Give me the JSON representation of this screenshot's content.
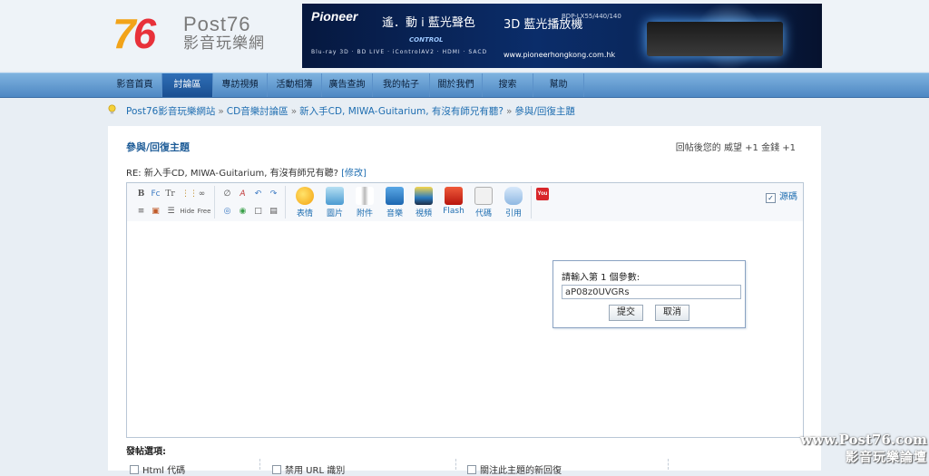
{
  "logo": {
    "num_seven": "7",
    "num_six": "6",
    "post": "Post76",
    "subtitle": "影音玩樂網"
  },
  "banner": {
    "brand": "Pioneer",
    "tagline": "遙．動 i 藍光聲色",
    "control": "CONTROL",
    "bd_text": "3D 藍光播放機",
    "model": "BDP-LX55/440/140",
    "url": "www.pioneerhongkong.com.hk",
    "logos": "Blu-ray 3D · BD LIVE · iControlAV2 · HDMI · SACD"
  },
  "nav": {
    "items": [
      "影音首頁",
      "討論區",
      "專訪視頻",
      "活動相簿",
      "廣告查詢",
      "我的帖子",
      "關於我們",
      "搜索",
      "幫助"
    ],
    "active_index": 1
  },
  "breadcrumb": {
    "items": [
      "Post76影音玩樂網站",
      "CD音樂討論區",
      "新入手CD, MIWA-Guitarium, 有沒有師兄有聽?",
      "參與/回復主題"
    ],
    "separator": "»"
  },
  "page": {
    "title": "參與/回復主題",
    "credit_text": "回帖後您的 威望 +1   金錢 +1",
    "subject": "RE: 新入手CD, MIWA-Guitarium, 有沒有師兄有聽?",
    "edit_link": "[修改]"
  },
  "toolbar": {
    "small_icons_row1": [
      "B",
      "Fc",
      "Tr",
      "⋮⋮",
      "∞",
      "∅",
      "A",
      "↶",
      "↷"
    ],
    "small_icons_row2": [
      "≡",
      "▣",
      "☰",
      "Hide",
      "Free",
      "◎",
      "◉",
      "□",
      "▤"
    ],
    "big": [
      "表情",
      "圖片",
      "附件",
      "音樂",
      "視頻",
      "Flash",
      "代碼",
      "引用"
    ],
    "youtube": "You",
    "source_label": "源碼",
    "source_checked": "✓"
  },
  "popup": {
    "prompt": "請輸入第 1 個參數:",
    "value": "aP08z0UVGRs",
    "submit": "提交",
    "cancel": "取消"
  },
  "options": {
    "heading": "發帖選項:",
    "items": [
      "Html 代碼",
      "禁用 URL 識別",
      "關注此主題的新回復"
    ]
  },
  "watermark": {
    "line1": "www.Post76.com",
    "line2": "影音玩樂論壇"
  },
  "colors": {
    "nav_active": "#1a4f91",
    "link": "#1f6eb1",
    "title": "#1f5d98"
  }
}
